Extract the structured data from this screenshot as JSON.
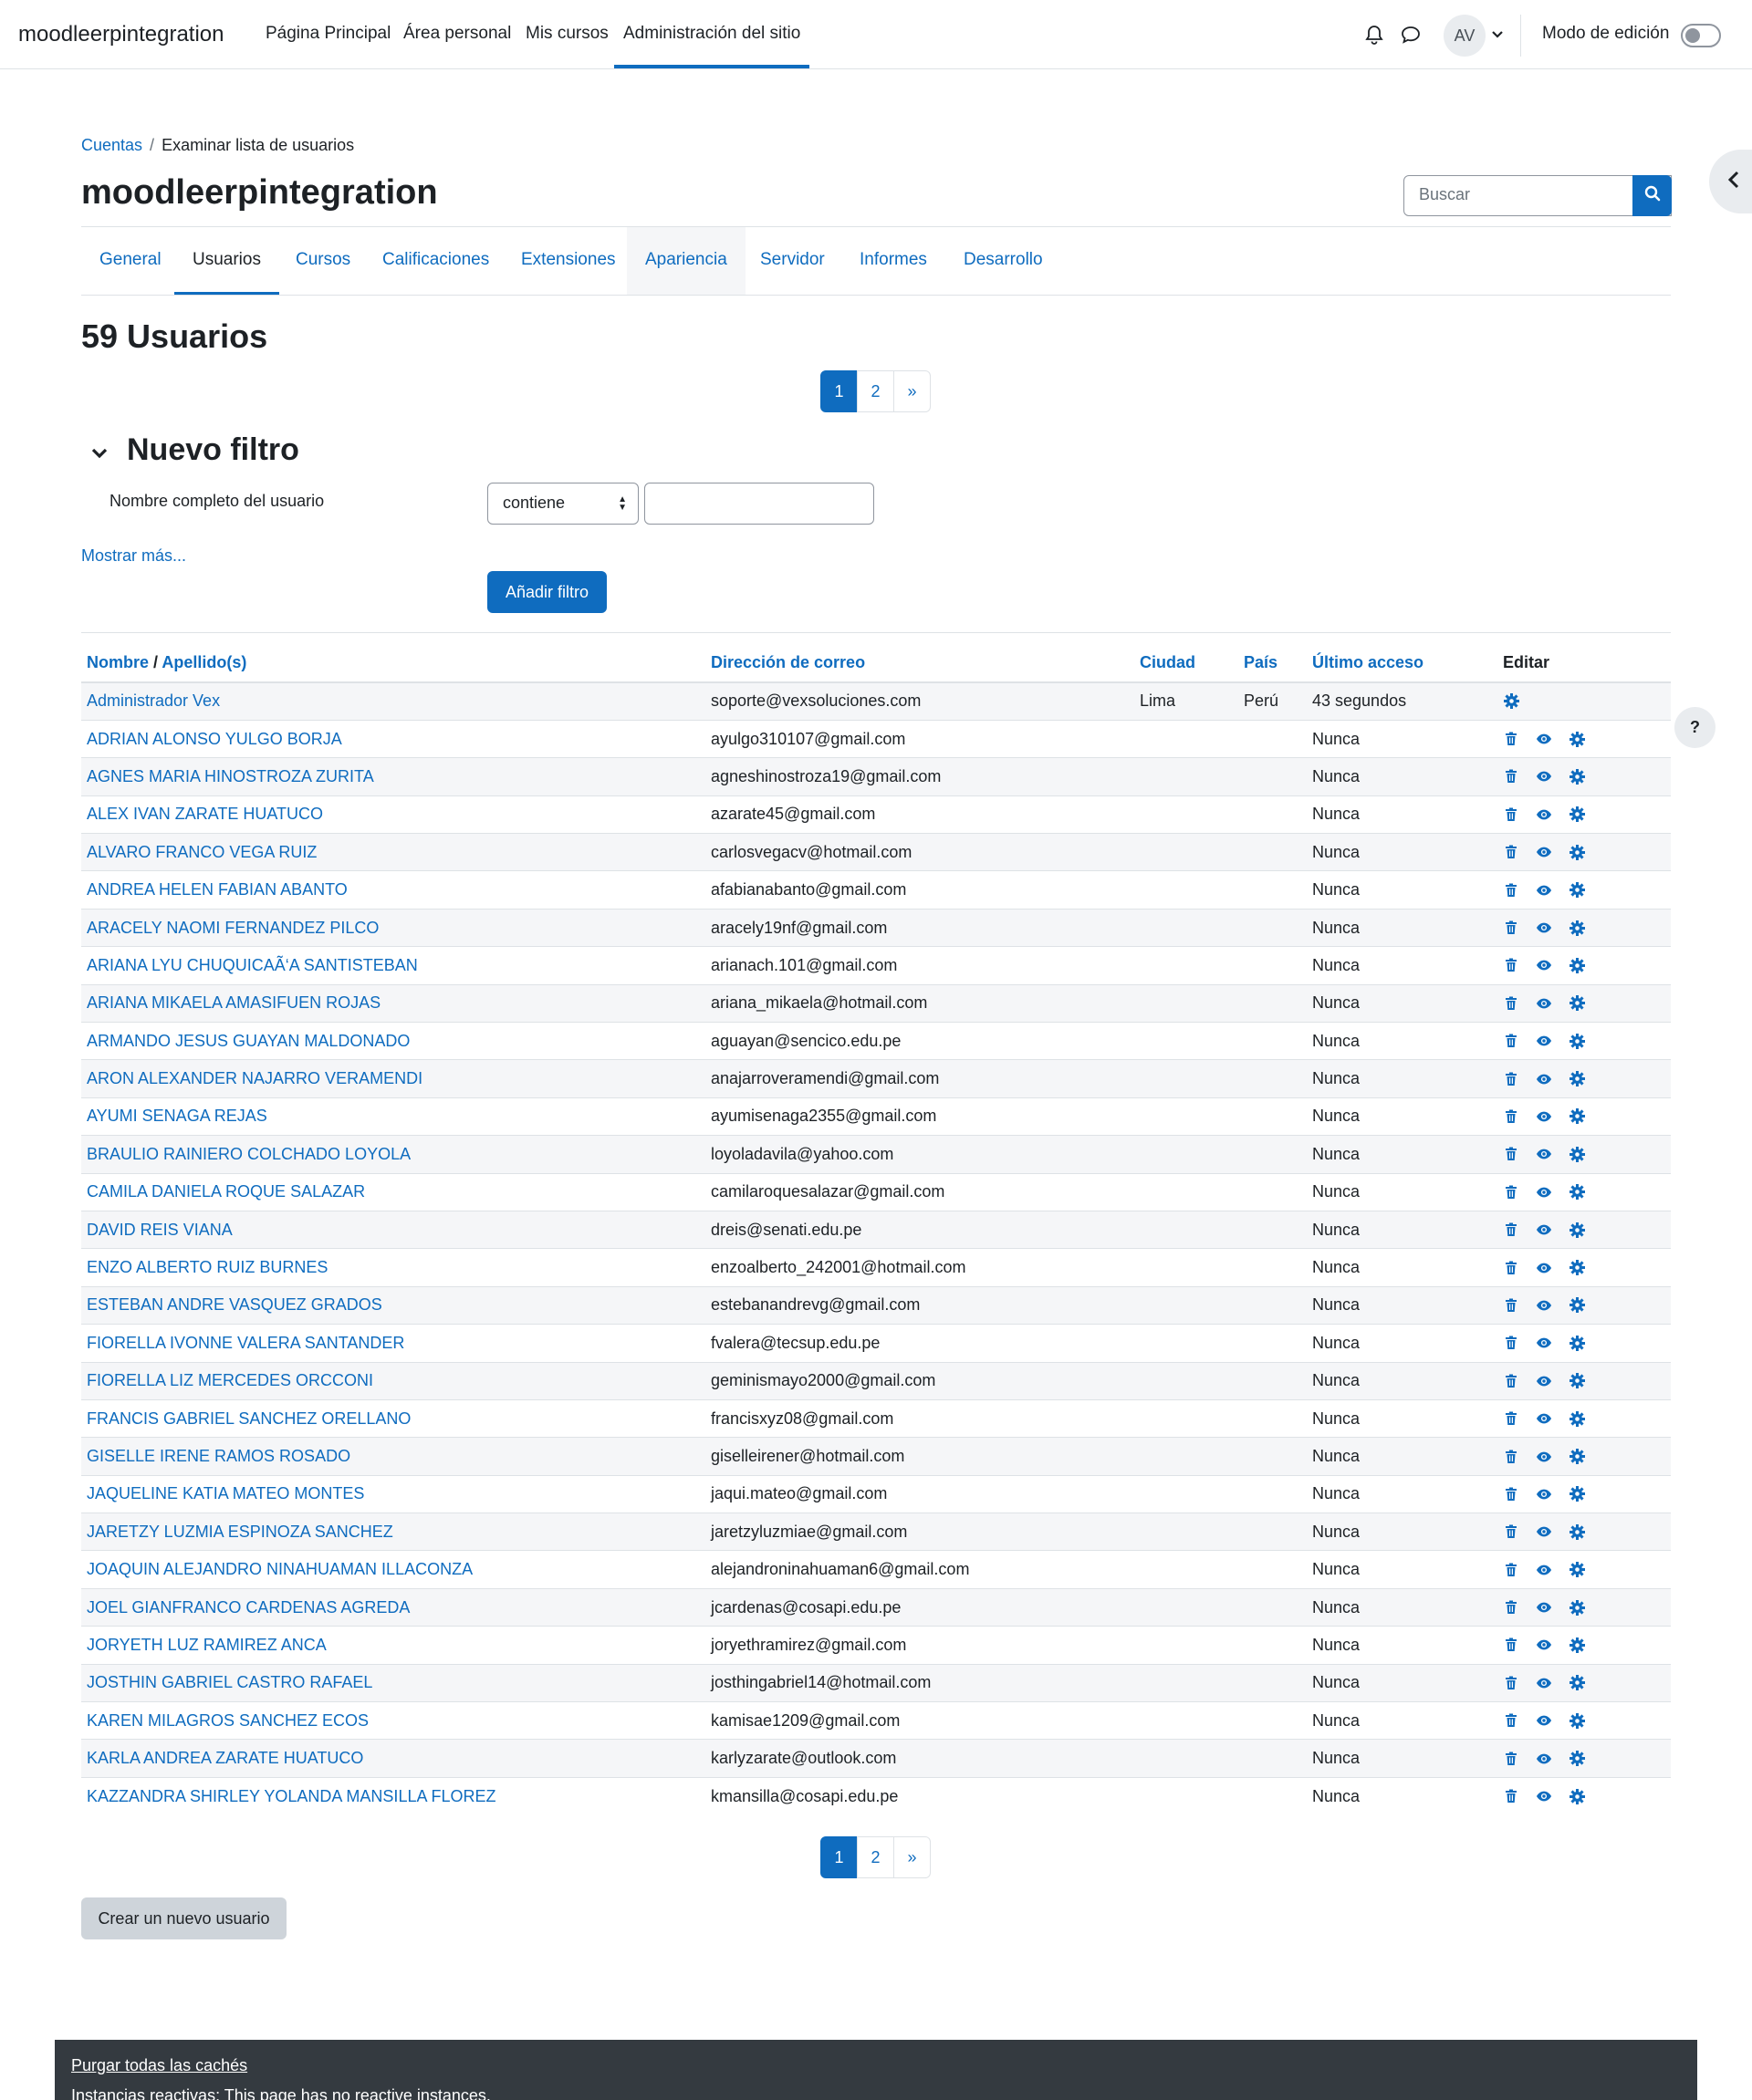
{
  "navbar": {
    "brand": "moodleerpintegration",
    "links": [
      "Página Principal",
      "Área personal",
      "Mis cursos",
      "Administración del sitio"
    ],
    "avatar_initials": "AV",
    "edit_mode_label": "Modo de edición",
    "edit_mode_on": false
  },
  "breadcrumb": {
    "parent": "Cuentas",
    "current": "Examinar lista de usuarios"
  },
  "page_title": "moodleerpintegration",
  "search": {
    "placeholder": "Buscar"
  },
  "tabs": [
    "General",
    "Usuarios",
    "Cursos",
    "Calificaciones",
    "Extensiones",
    "Apariencia",
    "Servidor",
    "Informes",
    "Desarrollo"
  ],
  "active_tab": "Usuarios",
  "users_title": "59 Usuarios",
  "pagination": {
    "pages": [
      "1",
      "2"
    ],
    "next": "»",
    "current": "1"
  },
  "filter": {
    "title": "Nuevo filtro",
    "field_label": "Nombre completo del usuario",
    "operator": "contiene",
    "value": "",
    "show_more": "Mostrar más...",
    "add_button": "Añadir filtro"
  },
  "table": {
    "headers": {
      "name": "Nombre",
      "name_sep": " / ",
      "surname": "Apellido(s)",
      "email": "Dirección de correo",
      "city": "Ciudad",
      "country": "País",
      "last_access": "Último acceso",
      "edit": "Editar"
    },
    "rows": [
      {
        "name": "Administrador Vex",
        "email": "soporte@vexsoluciones.com",
        "city": "Lima",
        "country": "Perú",
        "last_access": "43 segundos",
        "admin": true
      },
      {
        "name": "ADRIAN ALONSO YULGO BORJA",
        "email": "ayulgo310107@gmail.com",
        "city": "",
        "country": "",
        "last_access": "Nunca"
      },
      {
        "name": "AGNES MARIA HINOSTROZA ZURITA",
        "email": "agneshinostroza19@gmail.com",
        "city": "",
        "country": "",
        "last_access": "Nunca"
      },
      {
        "name": "ALEX IVAN ZARATE HUATUCO",
        "email": "azarate45@gmail.com",
        "city": "",
        "country": "",
        "last_access": "Nunca"
      },
      {
        "name": "ALVARO FRANCO VEGA RUIZ",
        "email": "carlosvegacv@hotmail.com",
        "city": "",
        "country": "",
        "last_access": "Nunca"
      },
      {
        "name": "ANDREA HELEN FABIAN ABANTO",
        "email": "afabianabanto@gmail.com",
        "city": "",
        "country": "",
        "last_access": "Nunca"
      },
      {
        "name": "ARACELY NAOMI FERNANDEZ PILCO",
        "email": "aracely19nf@gmail.com",
        "city": "",
        "country": "",
        "last_access": "Nunca"
      },
      {
        "name": "ARIANA LYU CHUQUICAÃ‘A SANTISTEBAN",
        "email": "arianach.101@gmail.com",
        "city": "",
        "country": "",
        "last_access": "Nunca"
      },
      {
        "name": "ARIANA MIKAELA AMASIFUEN ROJAS",
        "email": "ariana_mikaela@hotmail.com",
        "city": "",
        "country": "",
        "last_access": "Nunca"
      },
      {
        "name": "ARMANDO JESUS GUAYAN MALDONADO",
        "email": "aguayan@sencico.edu.pe",
        "city": "",
        "country": "",
        "last_access": "Nunca"
      },
      {
        "name": "ARON ALEXANDER NAJARRO VERAMENDI",
        "email": "anajarroveramendi@gmail.com",
        "city": "",
        "country": "",
        "last_access": "Nunca"
      },
      {
        "name": "AYUMI SENAGA REJAS",
        "email": "ayumisenaga2355@gmail.com",
        "city": "",
        "country": "",
        "last_access": "Nunca"
      },
      {
        "name": "BRAULIO RAINIERO COLCHADO LOYOLA",
        "email": "loyoladavila@yahoo.com",
        "city": "",
        "country": "",
        "last_access": "Nunca"
      },
      {
        "name": "CAMILA DANIELA ROQUE SALAZAR",
        "email": "camilaroquesalazar@gmail.com",
        "city": "",
        "country": "",
        "last_access": "Nunca"
      },
      {
        "name": "DAVID REIS VIANA",
        "email": "dreis@senati.edu.pe",
        "city": "",
        "country": "",
        "last_access": "Nunca"
      },
      {
        "name": "ENZO ALBERTO RUIZ BURNES",
        "email": "enzoalberto_242001@hotmail.com",
        "city": "",
        "country": "",
        "last_access": "Nunca"
      },
      {
        "name": "ESTEBAN ANDRE VASQUEZ GRADOS",
        "email": "estebanandrevg@gmail.com",
        "city": "",
        "country": "",
        "last_access": "Nunca"
      },
      {
        "name": "FIORELLA IVONNE VALERA SANTANDER",
        "email": "fvalera@tecsup.edu.pe",
        "city": "",
        "country": "",
        "last_access": "Nunca"
      },
      {
        "name": "FIORELLA LIZ MERCEDES ORCCONI",
        "email": "geminismayo2000@gmail.com",
        "city": "",
        "country": "",
        "last_access": "Nunca"
      },
      {
        "name": "FRANCIS GABRIEL SANCHEZ ORELLANO",
        "email": "francisxyz08@gmail.com",
        "city": "",
        "country": "",
        "last_access": "Nunca"
      },
      {
        "name": "GISELLE IRENE RAMOS ROSADO",
        "email": "giselleirener@hotmail.com",
        "city": "",
        "country": "",
        "last_access": "Nunca"
      },
      {
        "name": "JAQUELINE KATIA MATEO MONTES",
        "email": "jaqui.mateo@gmail.com",
        "city": "",
        "country": "",
        "last_access": "Nunca"
      },
      {
        "name": "JARETZY LUZMIA ESPINOZA SANCHEZ",
        "email": "jaretzyluzmiae@gmail.com",
        "city": "",
        "country": "",
        "last_access": "Nunca"
      },
      {
        "name": "JOAQUIN ALEJANDRO NINAHUAMAN ILLACONZA",
        "email": "alejandroninahuaman6@gmail.com",
        "city": "",
        "country": "",
        "last_access": "Nunca"
      },
      {
        "name": "JOEL GIANFRANCO CARDENAS AGREDA",
        "email": "jcardenas@cosapi.edu.pe",
        "city": "",
        "country": "",
        "last_access": "Nunca"
      },
      {
        "name": "JORYETH LUZ RAMIREZ ANCA",
        "email": "joryethramirez@gmail.com",
        "city": "",
        "country": "",
        "last_access": "Nunca"
      },
      {
        "name": "JOSTHIN GABRIEL CASTRO RAFAEL",
        "email": "josthingabriel14@hotmail.com",
        "city": "",
        "country": "",
        "last_access": "Nunca"
      },
      {
        "name": "KAREN MILAGROS SANCHEZ ECOS",
        "email": "kamisae1209@gmail.com",
        "city": "",
        "country": "",
        "last_access": "Nunca"
      },
      {
        "name": "KARLA ANDREA ZARATE HUATUCO",
        "email": "karlyzarate@outlook.com",
        "city": "",
        "country": "",
        "last_access": "Nunca"
      },
      {
        "name": "KAZZANDRA SHIRLEY YOLANDA MANSILLA FLOREZ",
        "email": "kmansilla@cosapi.edu.pe",
        "city": "",
        "country": "",
        "last_access": "Nunca"
      }
    ]
  },
  "create_user_button": "Crear un nuevo usuario",
  "help_button": "?",
  "footer": {
    "purge_link": "Purgar todas las cachés",
    "reactive_text": "Instancias reactivas: This page has no reactive instances."
  },
  "icons": {
    "delete": "trash-icon",
    "view": "eye-icon",
    "edit": "gear-icon",
    "accent_color": "#0f6cbf"
  }
}
